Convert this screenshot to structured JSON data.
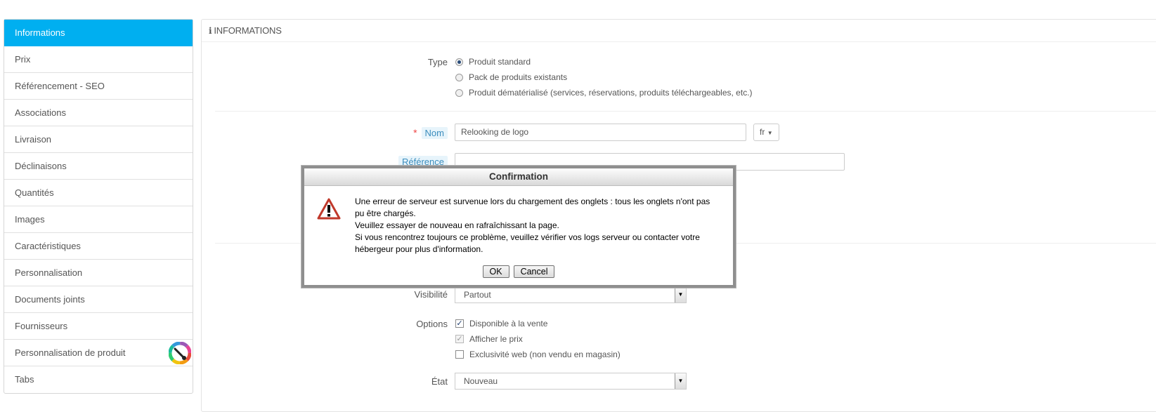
{
  "sidebar": {
    "items": [
      {
        "label": "Informations",
        "active": true
      },
      {
        "label": "Prix"
      },
      {
        "label": "Référencement - SEO"
      },
      {
        "label": "Associations"
      },
      {
        "label": "Livraison"
      },
      {
        "label": "Déclinaisons"
      },
      {
        "label": "Quantités"
      },
      {
        "label": "Images"
      },
      {
        "label": "Caractéristiques"
      },
      {
        "label": "Personnalisation"
      },
      {
        "label": "Documents joints"
      },
      {
        "label": "Fournisseurs"
      },
      {
        "label": "Personnalisation de produit"
      },
      {
        "label": "Tabs"
      }
    ],
    "addon_icon": "color-wheel-icon"
  },
  "panel": {
    "title": "INFORMATIONS",
    "type_label": "Type",
    "type_options": [
      {
        "label": "Produit standard",
        "selected": true
      },
      {
        "label": "Pack de produits existants",
        "selected": false
      },
      {
        "label": "Produit dématérialisé (services, réservations, produits téléchargeables, etc.)",
        "selected": false
      }
    ],
    "name_label": "Nom",
    "name_value": "Relooking de logo",
    "lang_value": "fr",
    "reference_label": "Référence",
    "reference_value": "",
    "visibility_label": "Visibilité",
    "visibility_value": "Partout",
    "options_label": "Options",
    "options": [
      {
        "label": "Disponible à la vente",
        "checked": true
      },
      {
        "label": "Afficher le prix",
        "checked": true
      },
      {
        "label": "Exclusivité web (non vendu en magasin)",
        "checked": false
      }
    ],
    "state_label": "État",
    "state_value": "Nouveau"
  },
  "dialog": {
    "title": "Confirmation",
    "lines": [
      "Une erreur de serveur est survenue lors du chargement des onglets : tous les onglets n'ont pas pu être chargés.",
      "Veuillez essayer de nouveau en rafraîchissant la page.",
      "Si vous rencontrez toujours ce problème, veuillez vérifier vos logs serveur ou contacter votre hébergeur pour plus d'information."
    ],
    "ok_label": "OK",
    "cancel_label": "Cancel"
  },
  "colors": {
    "active_tab": "#00aff0",
    "label_tag": "#3b8dbd",
    "required": "#e44444"
  }
}
